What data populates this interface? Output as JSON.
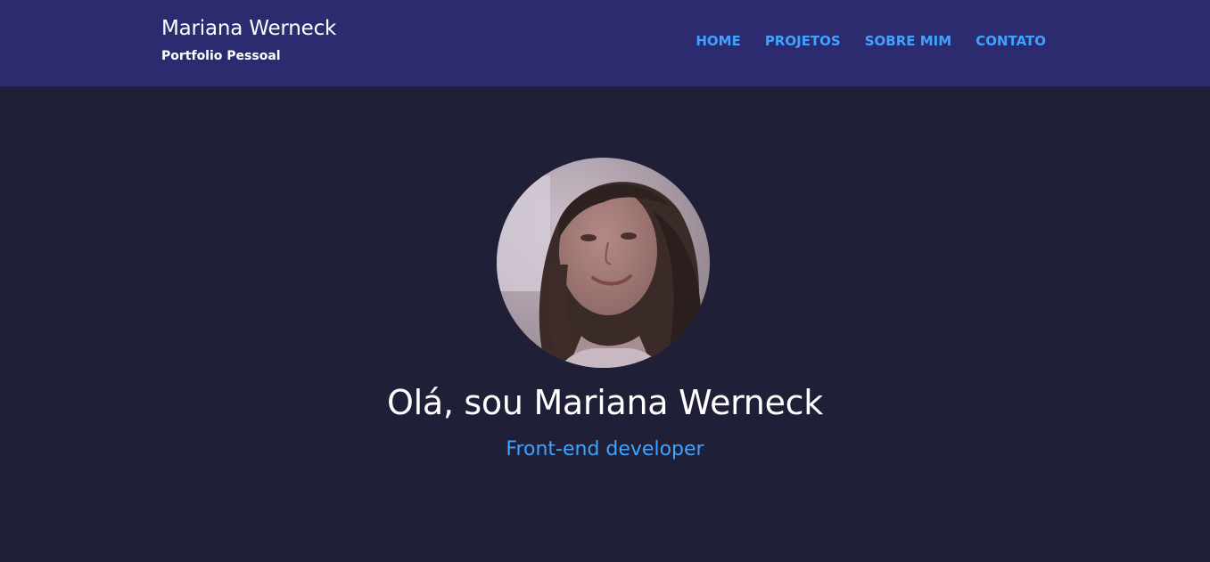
{
  "header": {
    "brand_name": "Mariana Werneck",
    "brand_subtitle": "Portfolio Pessoal",
    "nav": [
      {
        "label": "HOME"
      },
      {
        "label": "PROJETOS"
      },
      {
        "label": "SOBRE MIM"
      },
      {
        "label": "CONTATO"
      }
    ]
  },
  "hero": {
    "title": "Olá, sou Mariana Werneck",
    "subtitle": "Front-end developer"
  },
  "colors": {
    "header_bg": "#2c2b70",
    "page_bg": "#1f1f38",
    "accent": "#3fa2ff",
    "text": "#ffffff"
  }
}
